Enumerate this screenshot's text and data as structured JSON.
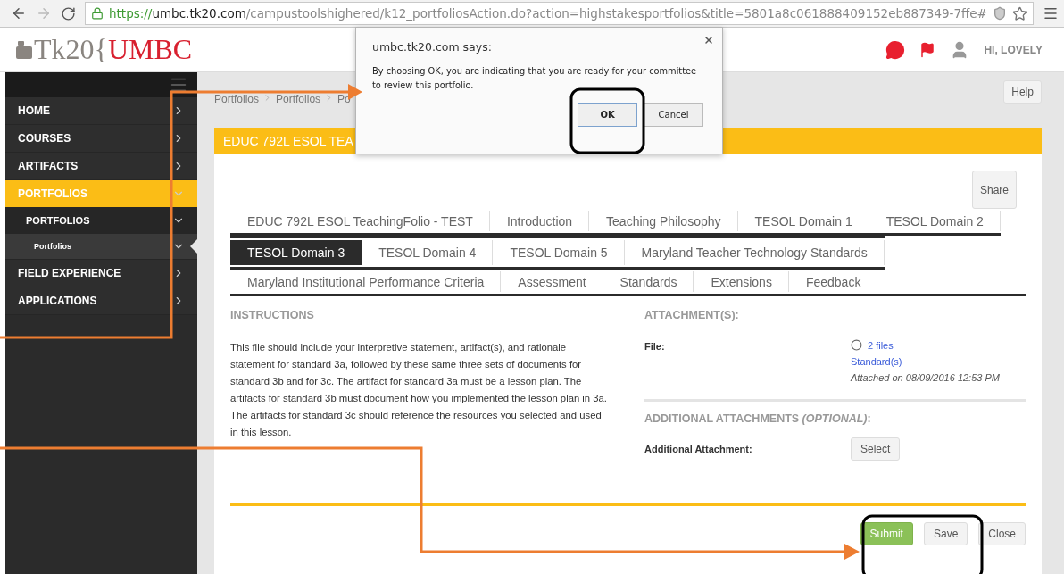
{
  "browser": {
    "url_scheme": "https://",
    "url_host": "umbc.tk20.com",
    "url_path": "/campustoolshighered/k12_portfoliosAction.do?action=highstakesportfolios&title=5801a8c061888409152eb887349-7ffe#"
  },
  "header": {
    "logo_brand": "Tk20{",
    "logo_school": "UMBC",
    "greeting": "HI, LOVELY"
  },
  "sidebar": {
    "items": [
      {
        "label": "HOME",
        "selected": false,
        "expanded": false
      },
      {
        "label": "COURSES",
        "selected": false,
        "expanded": false
      },
      {
        "label": "ARTIFACTS",
        "selected": false,
        "expanded": false
      },
      {
        "label": "PORTFOLIOS",
        "selected": true,
        "expanded": true,
        "children": [
          {
            "label": "PORTFOLIOS",
            "selected": false,
            "expanded": true,
            "children": [
              {
                "label": "Portfolios",
                "selected": true,
                "expanded": true
              }
            ]
          }
        ]
      },
      {
        "label": "FIELD EXPERIENCE",
        "selected": false,
        "expanded": false
      },
      {
        "label": "APPLICATIONS",
        "selected": false,
        "expanded": false
      }
    ]
  },
  "breadcrumb": [
    "Portfolios",
    "Portfolios",
    "Po"
  ],
  "help_button": "Help",
  "card": {
    "title": "EDUC 792L ESOL TEA",
    "share_button": "Share"
  },
  "tab_rows": [
    {
      "tabs": [
        {
          "label": "EDUC 792L ESOL TeachingFolio - TEST",
          "selected": false
        },
        {
          "label": "Introduction",
          "selected": false
        },
        {
          "label": "Teaching Philosophy",
          "selected": false
        },
        {
          "label": "TESOL Domain 1",
          "selected": false
        },
        {
          "label": "TESOL Domain 2",
          "selected": false
        }
      ]
    },
    {
      "tabs": [
        {
          "label": "TESOL Domain 3",
          "selected": true
        },
        {
          "label": "TESOL Domain 4",
          "selected": false
        },
        {
          "label": "TESOL Domain 5",
          "selected": false
        },
        {
          "label": "Maryland Teacher Technology Standards",
          "selected": false
        }
      ]
    },
    {
      "tabs": [
        {
          "label": "Maryland Institutional Performance Criteria",
          "selected": false
        },
        {
          "label": "Assessment",
          "selected": false
        },
        {
          "label": "Standards",
          "selected": false
        },
        {
          "label": "Extensions",
          "selected": false
        },
        {
          "label": "Feedback",
          "selected": false
        }
      ]
    }
  ],
  "instructions": {
    "heading": "INSTRUCTIONS",
    "text": "This file should include your interpretive statement, artifact(s), and rationale statement for standard 3a, followed by these same three sets of documents for standard 3b and for 3c. The artifact for standard 3a must be a lesson plan. The artifacts for standard 3b must document how you implemented the lesson plan in 3a. The artifacts for standard 3c should reference the resources you selected and used in this lesson."
  },
  "attachments": {
    "heading": "ATTACHMENT(S):",
    "file_label": "File:",
    "files_link": "2 files",
    "standards_link": "Standard(s)",
    "attached_on": "Attached on 08/09/2016 12:53 PM"
  },
  "additional": {
    "heading": "ADDITIONAL ATTACHMENTS *(OPTIONAL)*:",
    "label": "Additional Attachment:",
    "select_button": "Select"
  },
  "actions": [
    {
      "label": "Submit",
      "kind": "primary"
    },
    {
      "label": "Save",
      "kind": "secondary"
    },
    {
      "label": "Close",
      "kind": "secondary"
    }
  ],
  "dialog": {
    "title": "umbc.tk20.com says:",
    "message": "By choosing OK, you are indicating that you are ready for your committee to review this portfolio.",
    "ok": "OK",
    "cancel": "Cancel"
  }
}
